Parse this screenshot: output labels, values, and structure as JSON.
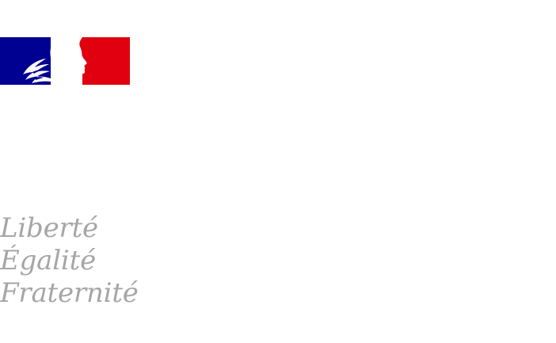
{
  "logo": {
    "colors": {
      "blue": "#000091",
      "white": "#ffffff",
      "red": "#e1000f",
      "motto_gray": "#a6a6a6"
    },
    "emblem_icon": "marianne-profile-icon",
    "motto": {
      "line1": "Liberté",
      "line2": "Égalité",
      "line3": "Fraternité"
    }
  }
}
